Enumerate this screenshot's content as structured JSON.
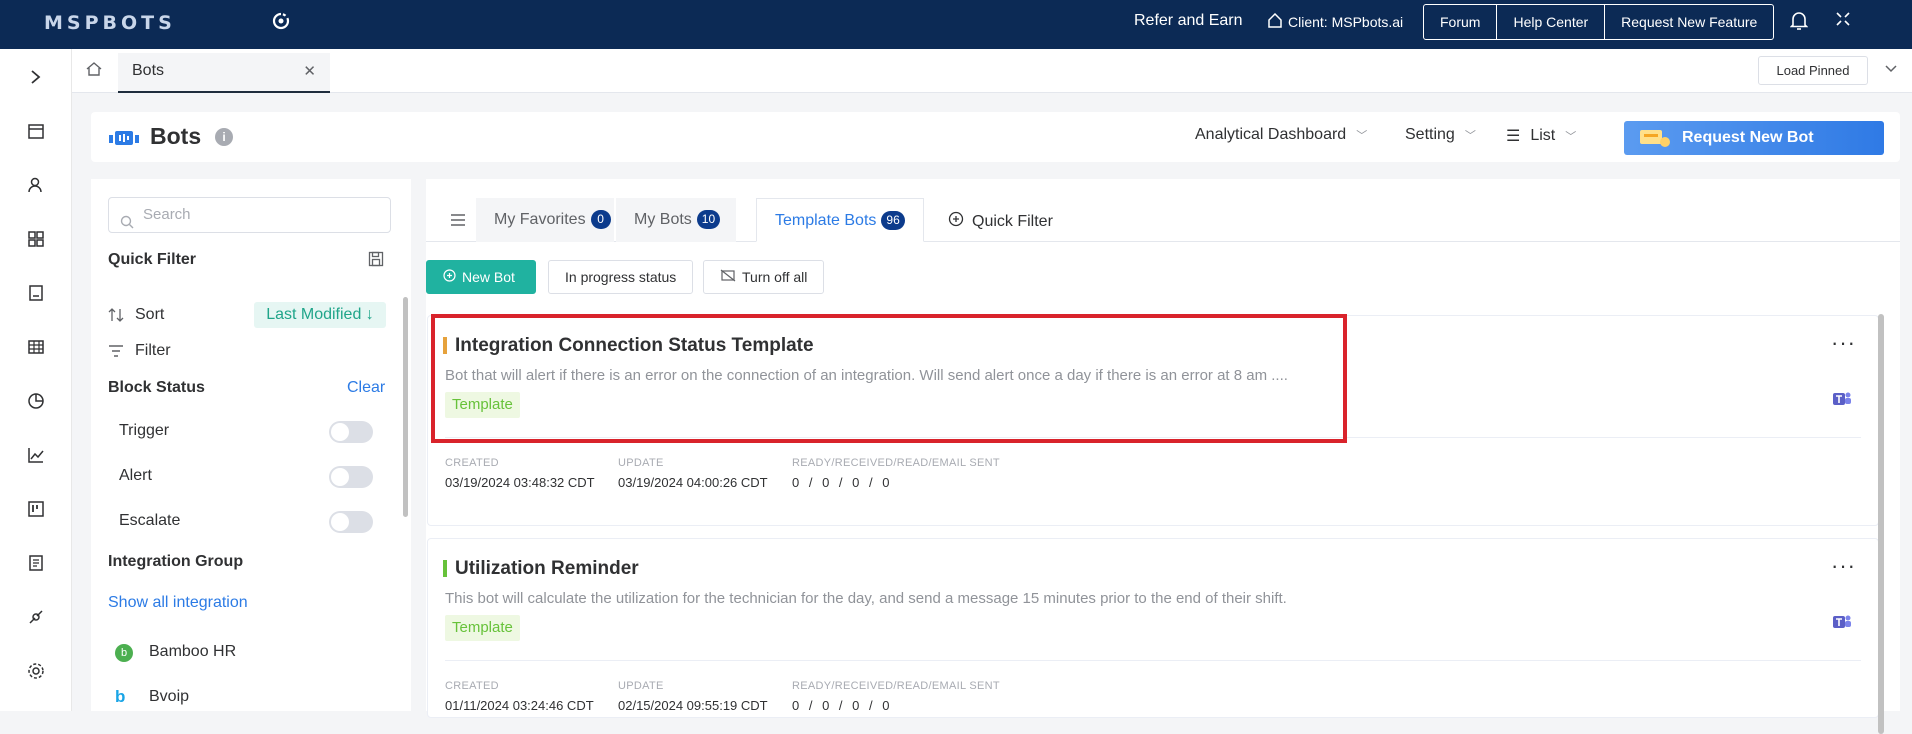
{
  "topbar": {
    "logo": "MSPBOTS",
    "refer": "Refer and Earn",
    "client": "Client: MSPbots.ai",
    "buttons": [
      "Forum",
      "Help Center",
      "Request New Feature"
    ]
  },
  "tabstrip": {
    "tab_label": "Bots",
    "load_pinned": "Load Pinned"
  },
  "header": {
    "title": "Bots",
    "menus": [
      "Analytical Dashboard",
      "Setting",
      "List"
    ],
    "request_button": "Request New Bot"
  },
  "left": {
    "search_placeholder": "Search",
    "quick_filter": "Quick Filter",
    "sort_label": "Sort",
    "sort_value": "Last Modified ↓",
    "filter_label": "Filter",
    "block_status": "Block Status",
    "clear": "Clear",
    "toggles": [
      "Trigger",
      "Alert",
      "Escalate"
    ],
    "integration_group": "Integration Group",
    "show_all": "Show all integration",
    "integrations": [
      "Bamboo HR",
      "Bvoip"
    ]
  },
  "main": {
    "tabs": [
      {
        "label": "My Favorites",
        "count": "0"
      },
      {
        "label": "My Bots",
        "count": "10"
      },
      {
        "label": "Template Bots",
        "count": "96"
      }
    ],
    "quick_filter": "Quick Filter",
    "actions": [
      "New Bot",
      "In progress status",
      "Turn off all"
    ],
    "meta_labels": [
      "CREATED",
      "UPDATE",
      "READY/RECEIVED/READ/EMAIL SENT"
    ],
    "cards": [
      {
        "title": "Integration Connection Status Template",
        "description": "Bot that will alert if there is an error on the connection of an integration. Will send alert once a day if there is an error at 8 am ....",
        "tag": "Template",
        "created": "03/19/2024 03:48:32 CDT",
        "updated": "03/19/2024 04:00:26 CDT",
        "stats": "0 / 0 / 0 / 0"
      },
      {
        "title": "Utilization Reminder",
        "description": "This bot will calculate the utilization for the technician for the day, and send a message 15 minutes prior to the end of their shift.",
        "tag": "Template",
        "created": "01/11/2024 03:24:46 CDT",
        "updated": "02/15/2024 09:55:19 CDT",
        "stats": "0 / 0 / 0 / 0"
      }
    ]
  },
  "colors": {
    "topbar": "#0c2a55",
    "accent": "#2c7be5",
    "primary_button": "#20b2a0",
    "highlight_box": "#d9232b"
  }
}
